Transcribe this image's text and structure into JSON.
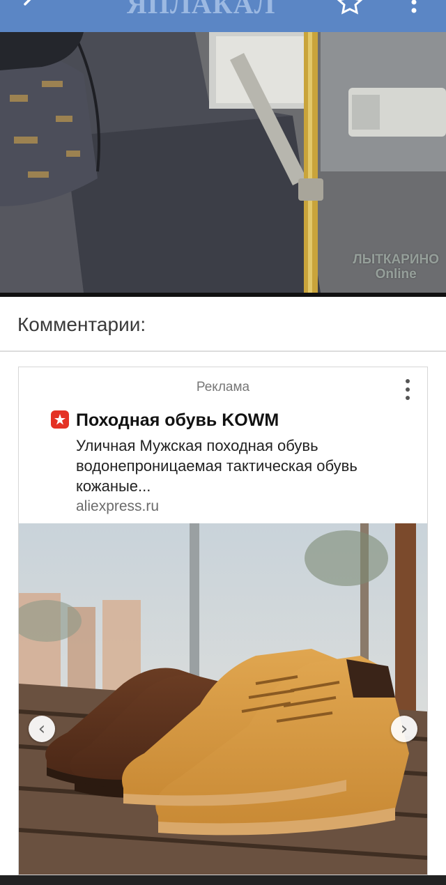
{
  "app": {
    "logo_text": "ЯПЛАКАЛ",
    "bar_color": "#5b86c5",
    "back_icon": "back-arrow-icon",
    "favorite_icon": "star-icon",
    "menu_icon": "more-vertical-icon"
  },
  "post": {
    "watermark_line1": "ЛЫТКАРИНО",
    "watermark_line2": "Online"
  },
  "comments": {
    "title": "Комментарии:"
  },
  "ad": {
    "label": "Реклама",
    "brand_icon": "aliexpress-icon",
    "title": "Походная обувь KOWM",
    "description": "Уличная Мужская походная обувь водонепроницаемая тактическая обувь кожаные...",
    "domain": "aliexpress.ru",
    "prev_glyph": "‹",
    "next_glyph": "›"
  }
}
